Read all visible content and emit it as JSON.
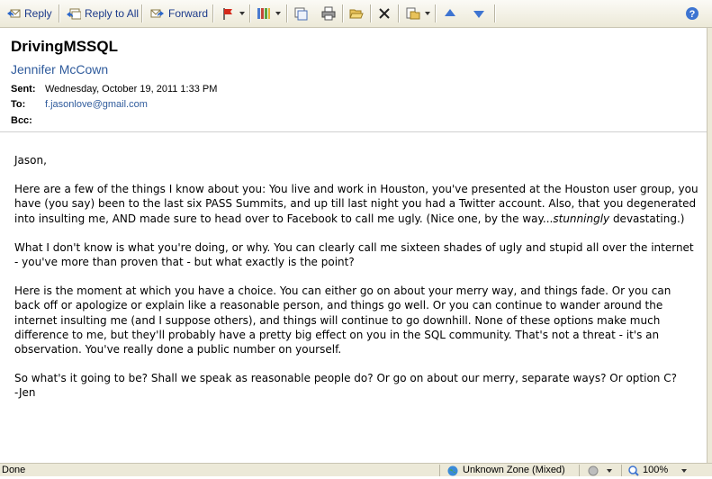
{
  "toolbar": {
    "reply": "Reply",
    "reply_all": "Reply to All",
    "forward": "Forward",
    "icons": [
      "reply-icon",
      "reply-all-icon",
      "forward-icon",
      "flag-icon",
      "categories-icon",
      "move-icon",
      "print-icon",
      "open-icon",
      "delete-icon",
      "copy-icon",
      "previous-icon",
      "next-icon",
      "help-icon"
    ]
  },
  "header": {
    "subject": "DrivingMSSQL",
    "sender": "Jennifer McCown",
    "sent_label": "Sent:",
    "sent_value": "Wednesday, October 19, 2011 1:33 PM",
    "to_label": "To:",
    "to_value": "f.jasonlove@gmail.com",
    "bcc_label": "Bcc:"
  },
  "body": {
    "greeting": "Jason,",
    "p1_a": "Here are a few of the things I know about you: You live and work in Houston, you've presented at the Houston user group, you have (you say) been to the last six PASS Summits, and up till last night you had a Twitter account.  Also, that you degenerated into insulting me, AND made sure to head over to Facebook to call me ugly. (Nice one, by the way...",
    "p1_em": "stunningly",
    "p1_b": " devastating.)",
    "p2": "What I don't know is what you're doing, or why. You can clearly call me sixteen shades of ugly and stupid all over the internet - you've more than proven that - but what exactly is the point?",
    "p3": "Here is the moment at which you have a choice. You can either go on about your merry way, and things fade. Or you can back off or apologize or explain like a reasonable person, and things go well. Or you can continue to wander around the internet insulting me (and I suppose others), and things will continue to go downhill.  None of these options make much difference to me, but they'll probably have a pretty big effect on you in the SQL community.  That's not a threat - it's an observation. You've really done a public number on yourself.",
    "p4": "So what's it going to be? Shall we speak as reasonable people do? Or go on about our merry, separate ways? Or option C?",
    "signoff": "-Jen"
  },
  "status": {
    "text": "Done",
    "zone": "Unknown Zone (Mixed)",
    "zoom": "100%"
  }
}
